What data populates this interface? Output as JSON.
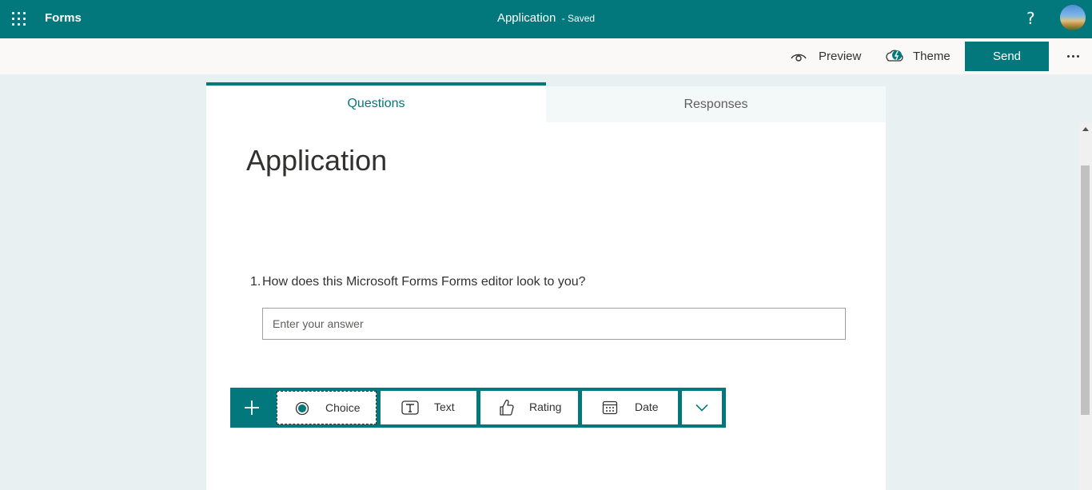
{
  "appbar": {
    "app_name": "Forms",
    "doc_title": "Application",
    "save_status": "Saved",
    "help_label": "?",
    "color": "#03787c"
  },
  "commands": {
    "preview_label": "Preview",
    "theme_label": "Theme",
    "send_label": "Send"
  },
  "tabs": [
    {
      "label": "Questions",
      "selected": true
    },
    {
      "label": "Responses",
      "selected": false
    }
  ],
  "form": {
    "title": "Application",
    "questions": [
      {
        "number": "1.",
        "text": "How does this Microsoft Forms Forms editor look to you?",
        "answer_placeholder": "Enter your answer",
        "answer_value": ""
      }
    ]
  },
  "add_question": {
    "plus_icon": "plus-icon",
    "types": [
      {
        "label": "Choice",
        "icon": "radio-icon"
      },
      {
        "label": "Text",
        "icon": "text-icon"
      },
      {
        "label": "Rating",
        "icon": "thumbs-up-icon"
      },
      {
        "label": "Date",
        "icon": "calendar-icon"
      }
    ],
    "more_icon": "chevron-down-icon"
  }
}
